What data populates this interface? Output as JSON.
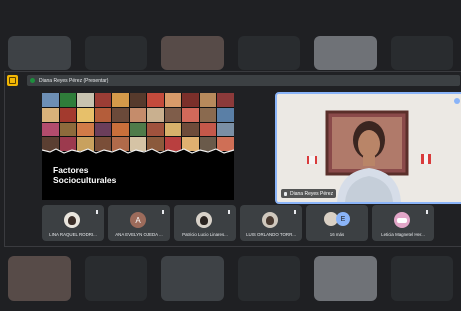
{
  "header": {
    "presenter_label": "Diana Reyes Pérez (Presentar)"
  },
  "slide": {
    "title_line1": "Factores",
    "title_line2": "Socioculturales"
  },
  "main_video": {
    "name": "Diana Reyes Pérez"
  },
  "participants": [
    {
      "name": "LINA RAQUEL RODRI...",
      "avatar": "photo",
      "color": "#e9e5dd"
    },
    {
      "name": "ANA EVELYN OJEDA ...",
      "avatar": "A",
      "color": "#9c6b5b"
    },
    {
      "name": "Patricio Lucio Linares...",
      "avatar": "photo",
      "color": "#d8d2c9"
    },
    {
      "name": "LUIS ORLANDO TORR...",
      "avatar": "photo",
      "color": "#cfc8bd"
    },
    {
      "name": "16 más",
      "avatar": "E",
      "color": "#8ab4f8"
    },
    {
      "name": "Leticia Magnetel Her...",
      "avatar": "photo",
      "color": "#e2a6c8"
    }
  ],
  "colors": {
    "accent": "#8ab4f8",
    "logo": "#f2b705",
    "background": "#1f2023"
  }
}
